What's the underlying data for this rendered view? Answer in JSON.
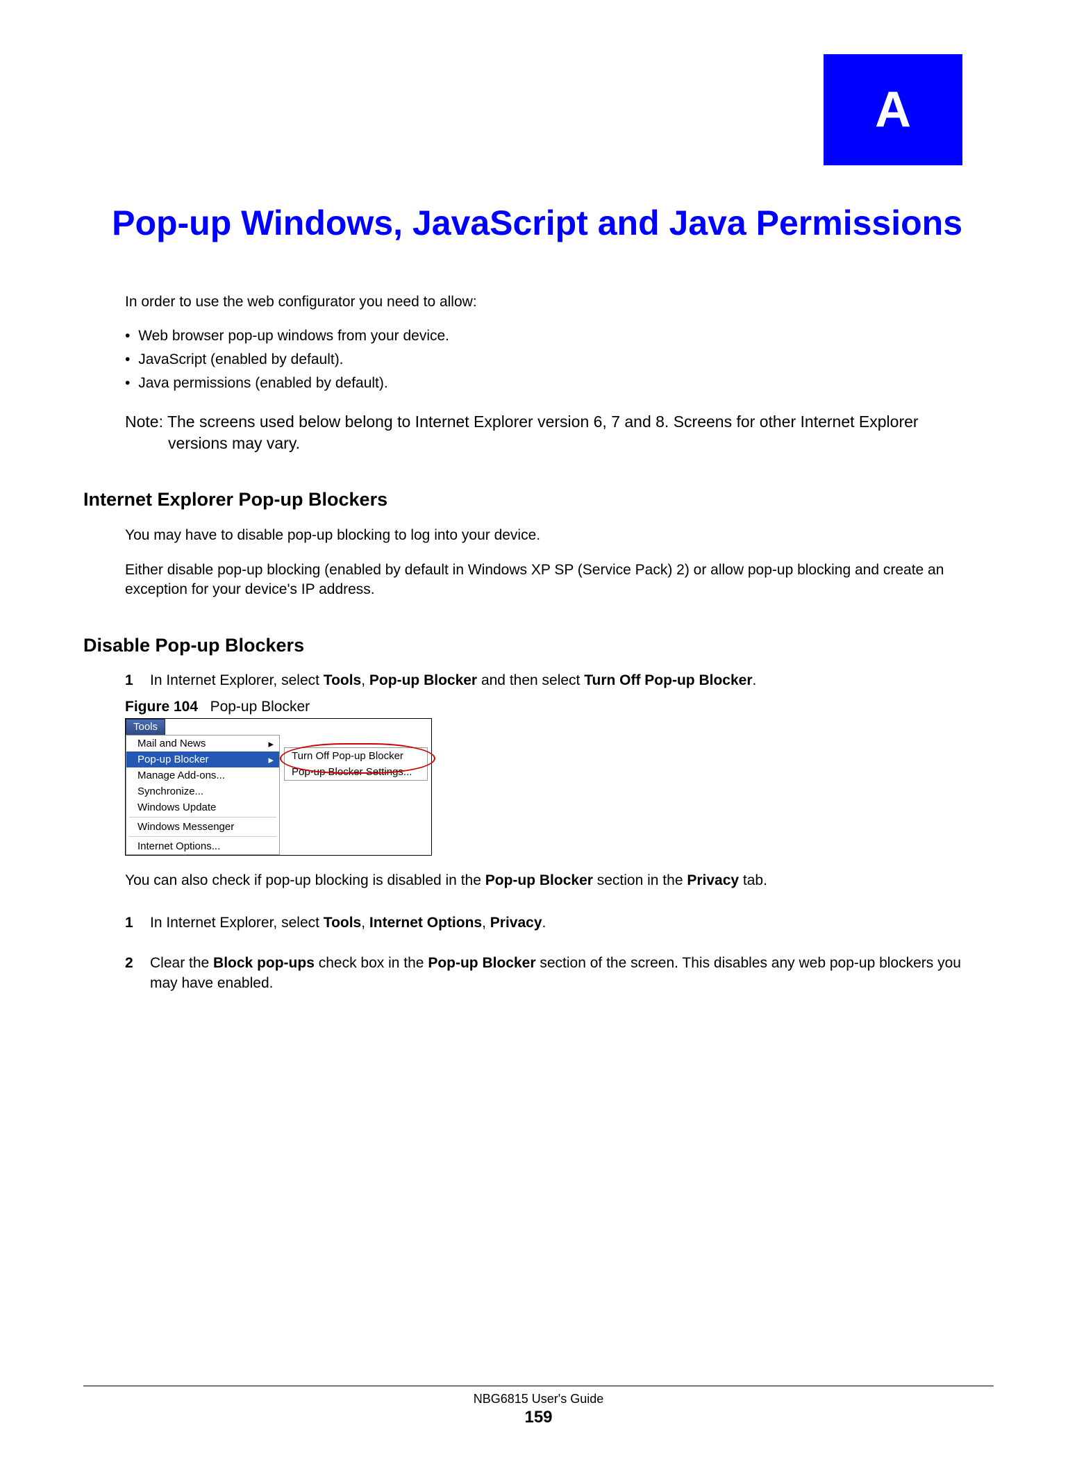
{
  "appendix_letter": "A",
  "chapter_title": "Pop-up Windows, JavaScript and Java Permissions",
  "intro": "In order to use the web configurator you need to allow:",
  "bullets": [
    "Web browser pop-up windows from your device.",
    "JavaScript (enabled by default).",
    "Java permissions (enabled by default)."
  ],
  "note": "Note: The screens used below belong to Internet Explorer version 6, 7 and 8. Screens for other Internet Explorer versions may vary.",
  "section1_heading": "Internet Explorer Pop-up Blockers",
  "section1_p1": "You may have to disable pop-up blocking to log into your device.",
  "section1_p2": "Either disable pop-up blocking (enabled by default in Windows XP SP (Service Pack) 2) or allow pop-up blocking and create an exception for your device's IP address.",
  "section2_heading": "Disable Pop-up Blockers",
  "step1_num": "1",
  "step1_pre": "In Internet Explorer, select ",
  "step1_bold1": "Tools",
  "step1_mid1": ", ",
  "step1_bold2": "Pop-up Blocker",
  "step1_mid2": " and then select ",
  "step1_bold3": "Turn Off Pop-up Blocker",
  "step1_post": ".",
  "figure_label": "Figure 104",
  "figure_title": "Pop-up Blocker",
  "menu": {
    "tools_btn": "Tools",
    "items": [
      "Mail and News",
      "Pop-up Blocker",
      "Manage Add-ons...",
      "Synchronize...",
      "Windows Update",
      "Windows Messenger",
      "Internet Options..."
    ],
    "submenu": [
      "Turn Off Pop-up Blocker",
      "Pop-up Blocker Settings..."
    ]
  },
  "after_figure_pre": "You can also check if pop-up blocking is disabled in the ",
  "after_figure_b1": "Pop-up Blocker",
  "after_figure_mid": " section in the ",
  "after_figure_b2": "Privacy",
  "after_figure_post": " tab.",
  "stepA_num": "1",
  "stepA_pre": "In Internet Explorer, select ",
  "stepA_b1": "Tools",
  "stepA_mid1": ", ",
  "stepA_b2": "Internet Options",
  "stepA_mid2": ", ",
  "stepA_b3": "Privacy",
  "stepA_post": ".",
  "stepB_num": "2",
  "stepB_pre": "Clear the ",
  "stepB_b1": "Block pop-ups",
  "stepB_mid1": " check box in the ",
  "stepB_b2": "Pop-up Blocker",
  "stepB_post": " section of the screen. This disables any web pop-up blockers you may have enabled.",
  "footer_guide": "NBG6815 User's Guide",
  "footer_page": "159"
}
